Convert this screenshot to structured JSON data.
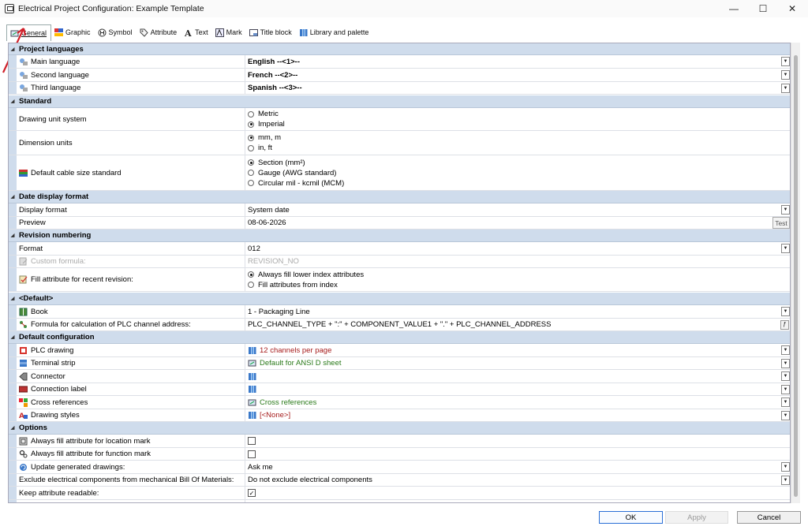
{
  "window": {
    "title": "Electrical Project Configuration: Example Template",
    "minimize_glyph": "—",
    "maximize_glyph": "☐",
    "close_glyph": "✕"
  },
  "tabs": [
    {
      "label": "General",
      "icon": "project-icon",
      "active": true
    },
    {
      "label": "Graphic",
      "icon": "graphic-icon"
    },
    {
      "label": "Symbol",
      "icon": "symbol-icon"
    },
    {
      "label": "Attribute",
      "icon": "attribute-tag-icon"
    },
    {
      "label": "Text",
      "icon": "text-icon"
    },
    {
      "label": "Mark",
      "icon": "mark-icon"
    },
    {
      "label": "Title block",
      "icon": "title-block-icon"
    },
    {
      "label": "Library and palette",
      "icon": "library-icon"
    }
  ],
  "sections": {
    "project_languages": "Project languages",
    "standard": "Standard",
    "date_display_format": "Date display format",
    "revision_numbering": "Revision numbering",
    "default": "<Default>",
    "default_configuration": "Default configuration",
    "options": "Options"
  },
  "languages": {
    "main_label": "Main language",
    "main_value": "English  --<1>--",
    "second_label": "Second language",
    "second_value": "French  --<2>--",
    "third_label": "Third language",
    "third_value": "Spanish  --<3>--"
  },
  "standard": {
    "unit_label": "Drawing unit system",
    "unit_options": [
      "Metric",
      "Imperial"
    ],
    "unit_selected": "Imperial",
    "dim_label": "Dimension units",
    "dim_options": [
      "mm, m",
      "in, ft"
    ],
    "dim_selected": "mm, m",
    "cable_label": "Default cable size standard",
    "cable_options": [
      "Section (mm²)",
      "Gauge (AWG standard)",
      "Circular mil - kcmil (MCM)"
    ],
    "cable_selected": "Section (mm²)"
  },
  "date": {
    "display_label": "Display format",
    "display_value": "System date",
    "preview_label": "Preview",
    "preview_value": "08-06-2026",
    "test_button": "Test"
  },
  "revision": {
    "format_label": "Format",
    "format_value": "012",
    "formula_label": "Custom formula:",
    "formula_value": "REVISION_NO",
    "fill_label": "Fill attribute for recent revision:",
    "fill_options": [
      "Always fill lower index attributes",
      "Fill attributes from index"
    ],
    "fill_selected": "Always fill lower index attributes"
  },
  "default_group": {
    "book_label": "Book",
    "book_value": "1 - Packaging Line",
    "plc_formula_label": "Formula for calculation of PLC channel address:",
    "plc_formula_value": "PLC_CHANNEL_TYPE + \":\" + COMPONENT_VALUE1 + \".\" + PLC_CHANNEL_ADDRESS"
  },
  "default_config": {
    "plc_label": "PLC drawing",
    "plc_value": "12 channels per page",
    "terminal_label": "Terminal strip",
    "terminal_value": "Default for ANSI D sheet",
    "connector_label": "Connector",
    "connection_label_label": "Connection label",
    "crossref_label": "Cross references",
    "crossref_value": "Cross references",
    "styles_label": "Drawing styles",
    "styles_value": "[<None>]"
  },
  "options": {
    "location_label": "Always fill attribute for location mark",
    "function_label": "Always fill attribute for function mark",
    "update_label": "Update generated drawings:",
    "update_value": "Ask me",
    "exclude_label": "Exclude electrical components from mechanical Bill Of Materials:",
    "exclude_value": "Do not exclude electrical components",
    "readable_label": "Keep attribute readable:",
    "location_checked": false,
    "function_checked": false,
    "readable_checked": true
  },
  "footer": {
    "ok": "OK",
    "apply": "Apply",
    "cancel": "Cancel"
  },
  "colors": {
    "section_bg": "#cfdcec",
    "red_value": "#a61c1c",
    "green_value": "#2a7a1a",
    "annotation_arrow": "#d0202a"
  }
}
